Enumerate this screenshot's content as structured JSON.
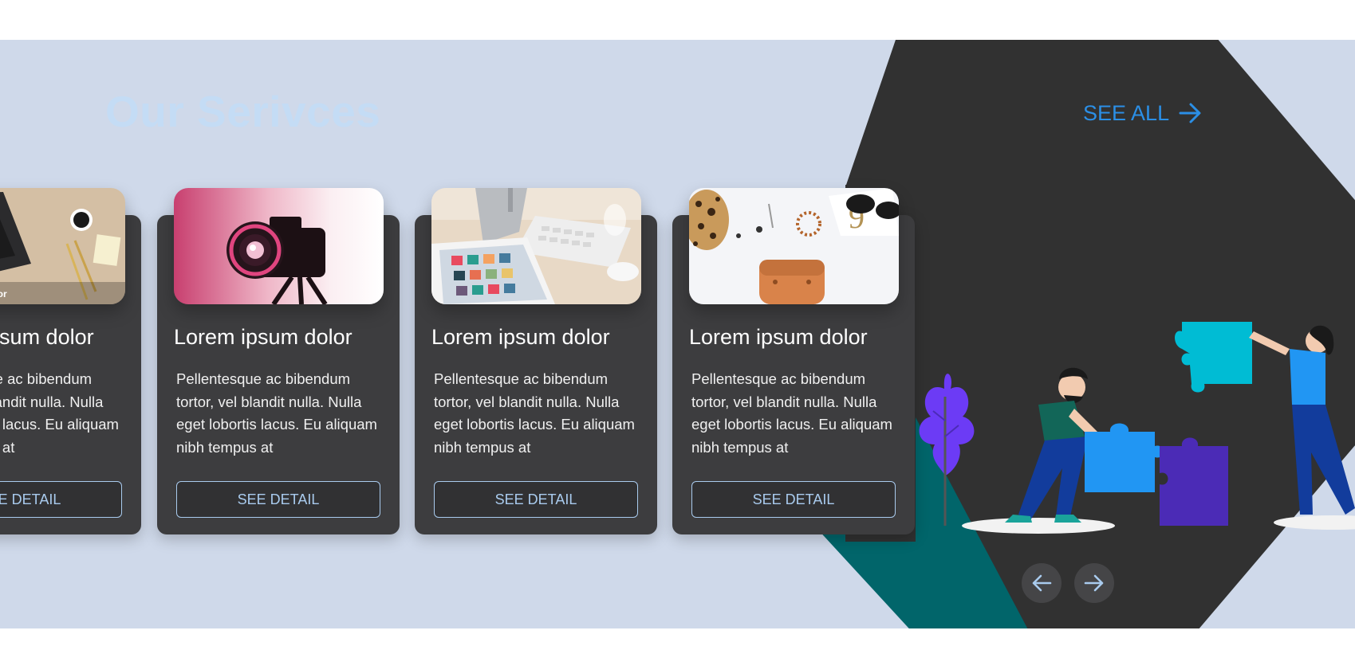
{
  "section": {
    "title": "Our Serivces",
    "see_all_label": "SEE ALL"
  },
  "cards": [
    {
      "title": "Lorem ipsum dolor",
      "description": "Pellentesque ac bibendum tortor, vel blandit nulla. Nulla eget lobortis lacus. Eu aliquam nibh tempus at",
      "button_label": "SEE DETAIL",
      "image_caption": "Lorem ipsum dolor",
      "image": "laptop-on-desk"
    },
    {
      "title": "Lorem ipsum dolor",
      "description": "Pellentesque ac bibendum tortor, vel blandit nulla. Nulla eget lobortis lacus. Eu aliquam nibh tempus at",
      "button_label": "SEE DETAIL",
      "image": "camera-on-tripod"
    },
    {
      "title": "Lorem ipsum dolor",
      "description": "Pellentesque ac bibendum tortor, vel blandit nulla. Nulla eget lobortis lacus. Eu aliquam nibh tempus at",
      "button_label": "SEE DETAIL",
      "image": "imac-and-tablet"
    },
    {
      "title": "Lorem ipsum dolor",
      "description": "Pellentesque ac bibendum tortor, vel blandit nulla. Nulla eget lobortis lacus. Eu aliquam nibh tempus at",
      "button_label": "SEE DETAIL",
      "image": "flatlay-accessories"
    }
  ],
  "carousel": {
    "prev_icon": "arrow-left-icon",
    "next_icon": "arrow-right-icon"
  },
  "illustration": "puzzle-teamwork",
  "colors": {
    "band_background": "#cfd9ea",
    "diamond_dark": "#313131",
    "diamond_accent": "#01656a",
    "card_background": "#3d3d3f",
    "link_blue": "#2b8fe6",
    "button_outline": "#a9cbee",
    "title_faded": "#c4dcf5"
  }
}
